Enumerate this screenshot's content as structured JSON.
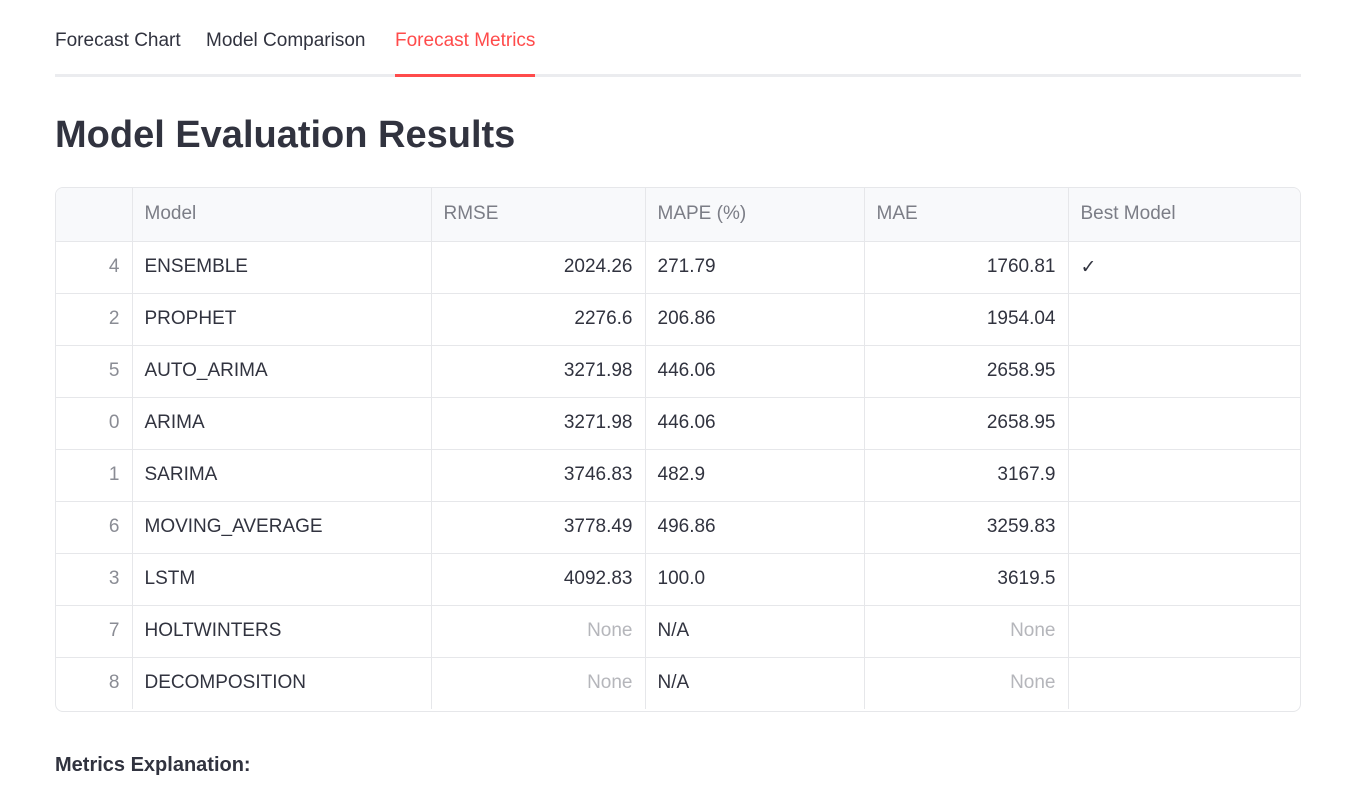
{
  "tabs": [
    {
      "label": "Forecast Chart"
    },
    {
      "label": "Model Comparison"
    },
    {
      "label": "Forecast Metrics"
    }
  ],
  "active_tab": "Forecast Metrics",
  "accent_color": "#ff4b4b",
  "page_title": "Model Evaluation Results",
  "table": {
    "columns": [
      "",
      "Model",
      "RMSE",
      "MAPE (%)",
      "MAE",
      "Best Model"
    ],
    "rows": [
      {
        "index": "4",
        "model": "ENSEMBLE",
        "rmse": "2024.26",
        "mape": "271.79",
        "mae": "1760.81",
        "best": "✓"
      },
      {
        "index": "2",
        "model": "PROPHET",
        "rmse": "2276.6",
        "mape": "206.86",
        "mae": "1954.04",
        "best": ""
      },
      {
        "index": "5",
        "model": "AUTO_ARIMA",
        "rmse": "3271.98",
        "mape": "446.06",
        "mae": "2658.95",
        "best": ""
      },
      {
        "index": "0",
        "model": "ARIMA",
        "rmse": "3271.98",
        "mape": "446.06",
        "mae": "2658.95",
        "best": ""
      },
      {
        "index": "1",
        "model": "SARIMA",
        "rmse": "3746.83",
        "mape": "482.9",
        "mae": "3167.9",
        "best": ""
      },
      {
        "index": "6",
        "model": "MOVING_AVERAGE",
        "rmse": "3778.49",
        "mape": "496.86",
        "mae": "3259.83",
        "best": ""
      },
      {
        "index": "3",
        "model": "LSTM",
        "rmse": "4092.83",
        "mape": "100.0",
        "mae": "3619.5",
        "best": ""
      },
      {
        "index": "7",
        "model": "HOLTWINTERS",
        "rmse": "None",
        "mape": "N/A",
        "mae": "None",
        "best": ""
      },
      {
        "index": "8",
        "model": "DECOMPOSITION",
        "rmse": "None",
        "mape": "N/A",
        "mae": "None",
        "best": ""
      }
    ]
  },
  "metrics_heading": "Metrics Explanation:"
}
